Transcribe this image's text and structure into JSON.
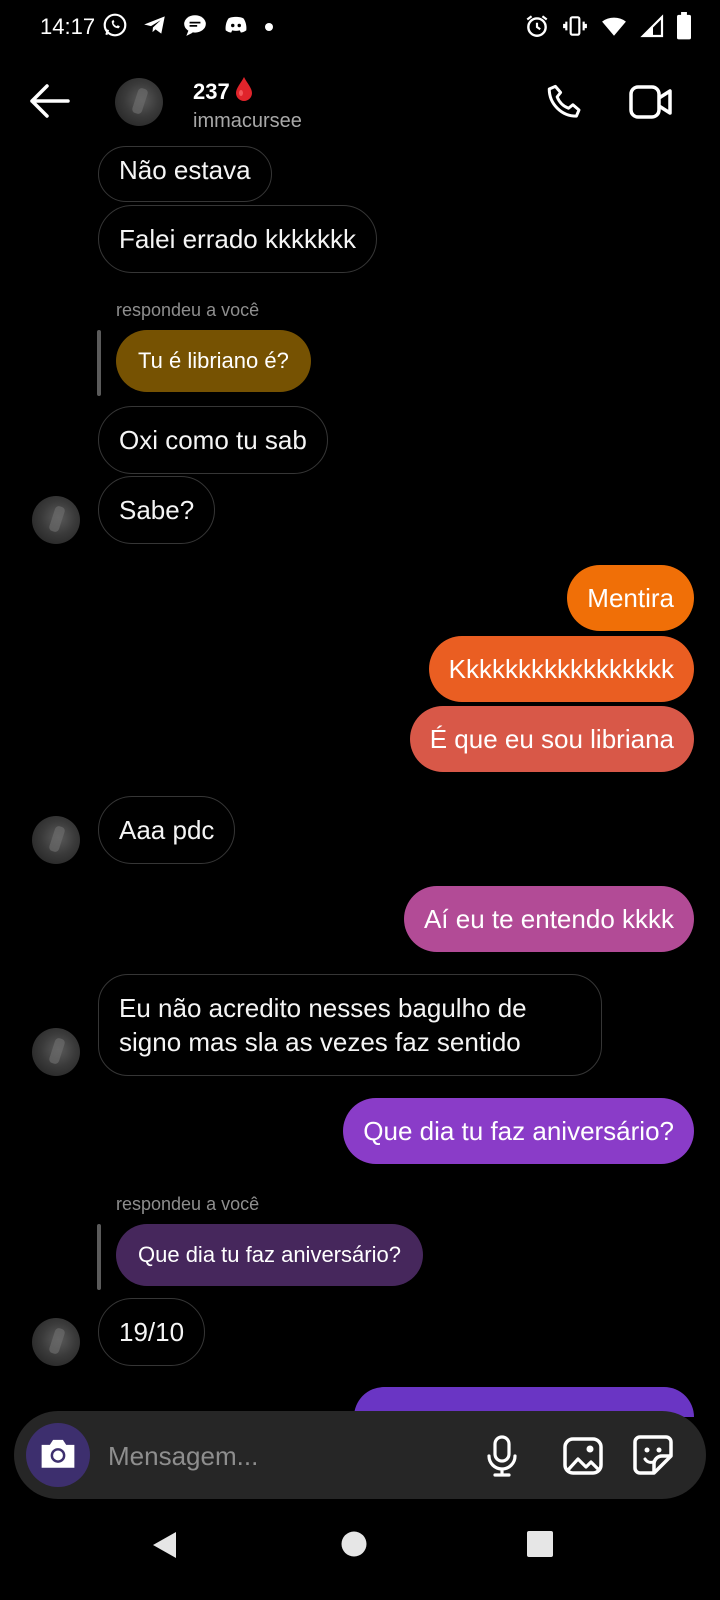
{
  "status_bar": {
    "time": "14:17"
  },
  "header": {
    "name": "237",
    "username": "immacursee",
    "back_icon": "arrow-left-icon",
    "call_icon": "phone-icon",
    "video_icon": "video-camera-icon"
  },
  "messages": [
    {
      "type": "received",
      "text": "Não estava"
    },
    {
      "type": "received",
      "text": "Falei errado kkkkkkk"
    },
    {
      "type": "received",
      "reply_label": "respondeu a você",
      "reply_quote": "Tu é libriano é?",
      "text": "Oxi como tu sab"
    },
    {
      "type": "received",
      "text": "Sabe?"
    },
    {
      "type": "sent",
      "text": "Mentira"
    },
    {
      "type": "sent",
      "text": "Kkkkkkkkkkkkkkkkk"
    },
    {
      "type": "sent",
      "text": "É que eu sou libriana"
    },
    {
      "type": "received",
      "text": "Aaa pdc"
    },
    {
      "type": "sent",
      "text": "Aí eu te entendo kkkk"
    },
    {
      "type": "received",
      "text": "Eu não acredito nesses bagulho de signo mas sla as vezes faz sentido"
    },
    {
      "type": "sent",
      "text": "Que dia tu faz aniversário?"
    },
    {
      "type": "received",
      "reply_label": "respondeu a você",
      "reply_quote": "Que dia tu faz aniversário?",
      "text": "19/10"
    }
  ],
  "composer": {
    "placeholder": "Mensagem...",
    "camera_icon": "camera-icon",
    "mic_icon": "microphone-icon",
    "gallery_icon": "image-icon",
    "sticker_icon": "sticker-icon"
  },
  "colors": {
    "accent": "#3d2f6e",
    "sent_gradient": [
      "#f06f07",
      "#ea5e22",
      "#d85848",
      "#b24b96",
      "#8a3cc8",
      "#6a35c4"
    ],
    "reply_brown": "#765202",
    "reply_purple": "#46275c"
  }
}
